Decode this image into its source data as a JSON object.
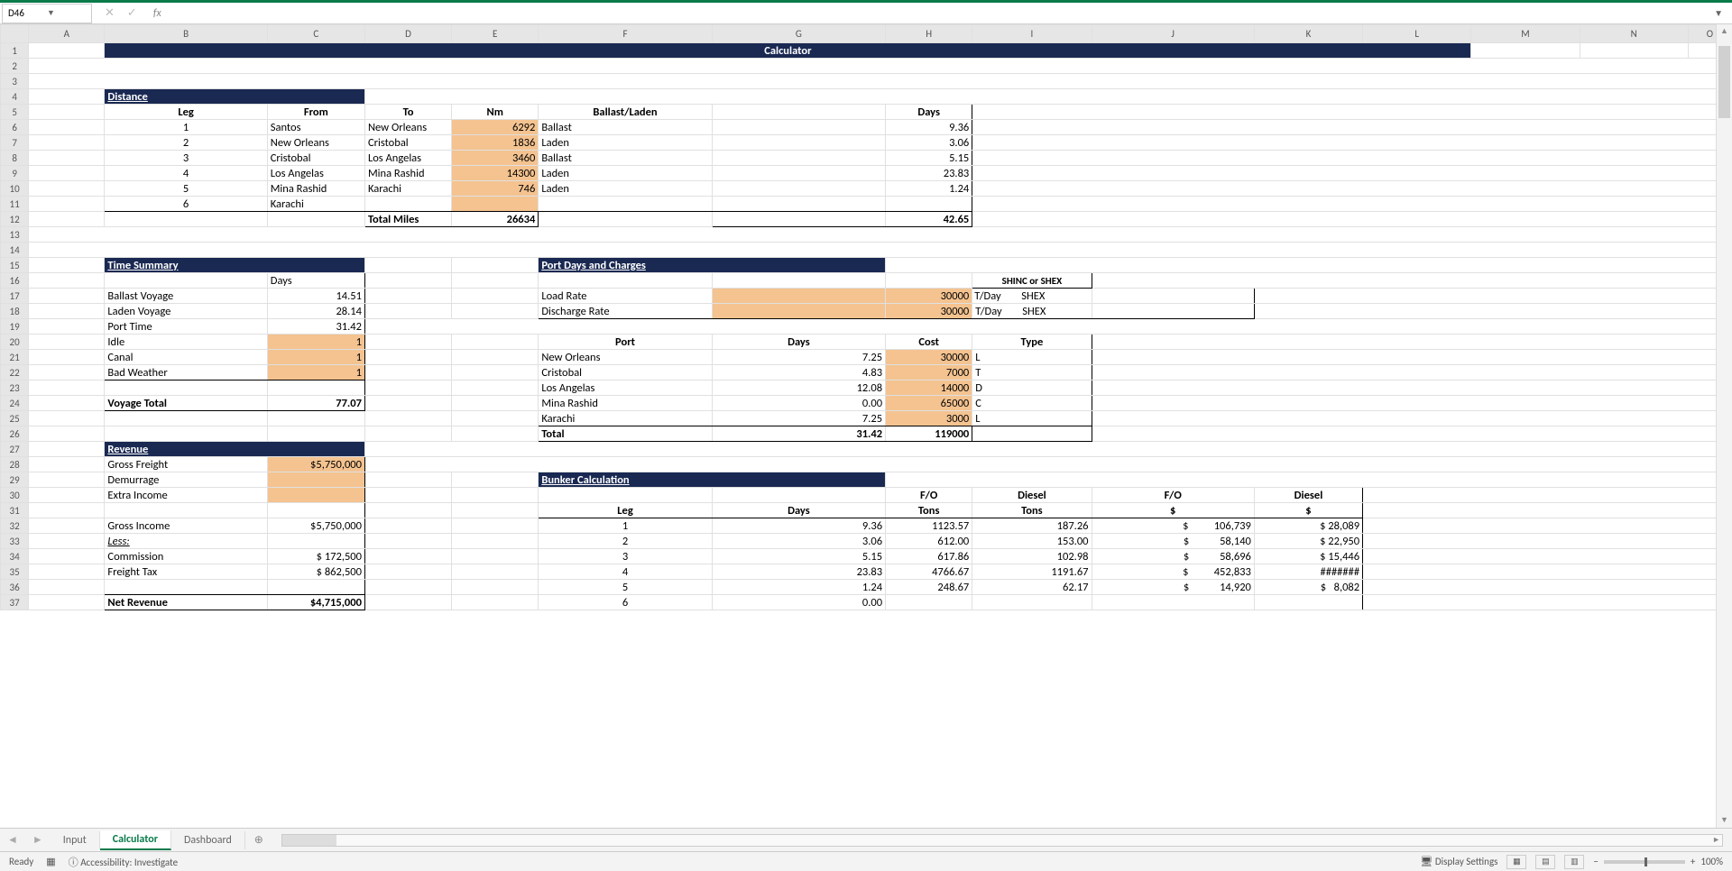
{
  "namebox": "D46",
  "title": "Calculator",
  "cols": [
    "A",
    "B",
    "C",
    "D",
    "E",
    "F",
    "G",
    "H",
    "I",
    "J",
    "K",
    "L",
    "M",
    "N",
    "O"
  ],
  "distance": {
    "header": "Distance",
    "cols": [
      "Leg",
      "From",
      "To",
      "Nm",
      "Ballast/Laden",
      "Days"
    ],
    "rows": [
      {
        "leg": "1",
        "from": "Santos",
        "to": "New Orleans",
        "nm": "6292",
        "bl": "Ballast",
        "days": "9.36"
      },
      {
        "leg": "2",
        "from": "New Orleans",
        "to": "Cristobal",
        "nm": "1836",
        "bl": "Laden",
        "days": "3.06"
      },
      {
        "leg": "3",
        "from": "Cristobal",
        "to": "Los Angelas",
        "nm": "3460",
        "bl": "Ballast",
        "days": "5.15"
      },
      {
        "leg": "4",
        "from": "Los Angelas",
        "to": "Mina Rashid",
        "nm": "14300",
        "bl": "Laden",
        "days": "23.83"
      },
      {
        "leg": "5",
        "from": "Mina Rashid",
        "to": "Karachi",
        "nm": "746",
        "bl": "Laden",
        "days": "1.24"
      },
      {
        "leg": "6",
        "from": "Karachi",
        "to": "",
        "nm": "",
        "bl": "",
        "days": ""
      }
    ],
    "totalLabel": "Total Miles",
    "totalMiles": "26634",
    "totalDays": "42.65"
  },
  "timeSummary": {
    "header": "Time Summary",
    "daysLabel": "Days",
    "rows": [
      {
        "label": "Ballast Voyage",
        "val": "14.51"
      },
      {
        "label": "Laden Voyage",
        "val": "28.14"
      },
      {
        "label": "Port Time",
        "val": "31.42"
      },
      {
        "label": "Idle",
        "val": "1",
        "peach": true
      },
      {
        "label": "Canal",
        "val": "1",
        "peach": true
      },
      {
        "label": "Bad Weather",
        "val": "1",
        "peach": true
      }
    ],
    "totalLabel": "Voyage Total",
    "totalVal": "77.07"
  },
  "portDays": {
    "header": "Port Days and Charges",
    "shincLabel": "SHINC or SHEX",
    "loadRate": {
      "label": "Load Rate",
      "val": "30000",
      "unit": "T/Day",
      "shex": "SHEX"
    },
    "dischRate": {
      "label": "Discharge Rate",
      "val": "30000",
      "unit": "T/Day",
      "shex": "SHEX"
    },
    "cols": [
      "Port",
      "Days",
      "Cost",
      "Type"
    ],
    "rows": [
      {
        "port": "New Orleans",
        "days": "7.25",
        "cost": "30000",
        "type": "L"
      },
      {
        "port": "Cristobal",
        "days": "4.83",
        "cost": "7000",
        "type": "T"
      },
      {
        "port": "Los Angelas",
        "days": "12.08",
        "cost": "14000",
        "type": "D"
      },
      {
        "port": "Mina Rashid",
        "days": "0.00",
        "cost": "65000",
        "type": "C"
      },
      {
        "port": "Karachi",
        "days": "7.25",
        "cost": "3000",
        "type": "L"
      }
    ],
    "totalLabel": "Total",
    "totalDays": "31.42",
    "totalCost": "119000"
  },
  "revenue": {
    "header": "Revenue",
    "rows": [
      {
        "label": "Gross Freight",
        "val": "$5,750,000",
        "peach": true
      },
      {
        "label": "Demurrage",
        "val": "",
        "peach": true
      },
      {
        "label": "Extra Income",
        "val": "",
        "peach": true
      }
    ],
    "grossIncome": {
      "label": "Gross Income",
      "val": "$5,750,000"
    },
    "less": "Less:",
    "deductions": [
      {
        "label": "Commission",
        "val": "$   172,500"
      },
      {
        "label": "Freight Tax",
        "val": "$   862,500"
      }
    ],
    "net": {
      "label": "Net Revenue",
      "val": "$4,715,000"
    }
  },
  "bunker": {
    "header": "Bunker Calculation",
    "topCols": [
      "F/O",
      "Diesel",
      "F/O",
      "Diesel"
    ],
    "subCols": [
      "Leg",
      "Days",
      "Tons",
      "Tons",
      "$",
      "$"
    ],
    "rows": [
      {
        "leg": "1",
        "days": "9.36",
        "foT": "1123.57",
        "dT": "187.26",
        "foD": "106,739",
        "dD": "28,089"
      },
      {
        "leg": "2",
        "days": "3.06",
        "foT": "612.00",
        "dT": "153.00",
        "foD": "58,140",
        "dD": "22,950"
      },
      {
        "leg": "3",
        "days": "5.15",
        "foT": "617.86",
        "dT": "102.98",
        "foD": "58,696",
        "dD": "15,446"
      },
      {
        "leg": "4",
        "days": "23.83",
        "foT": "4766.67",
        "dT": "1191.67",
        "foD": "452,833",
        "dD": "#######"
      },
      {
        "leg": "5",
        "days": "1.24",
        "foT": "248.67",
        "dT": "62.17",
        "foD": "14,920",
        "dD": "8,082"
      },
      {
        "leg": "6",
        "days": "0.00",
        "foT": "",
        "dT": "",
        "foD": "",
        "dD": ""
      }
    ]
  },
  "tabs": [
    "Input",
    "Calculator",
    "Dashboard"
  ],
  "activeTab": 1,
  "status": {
    "ready": "Ready",
    "acc": "Accessibility: Investigate",
    "display": "Display Settings",
    "zoom": "100%"
  }
}
